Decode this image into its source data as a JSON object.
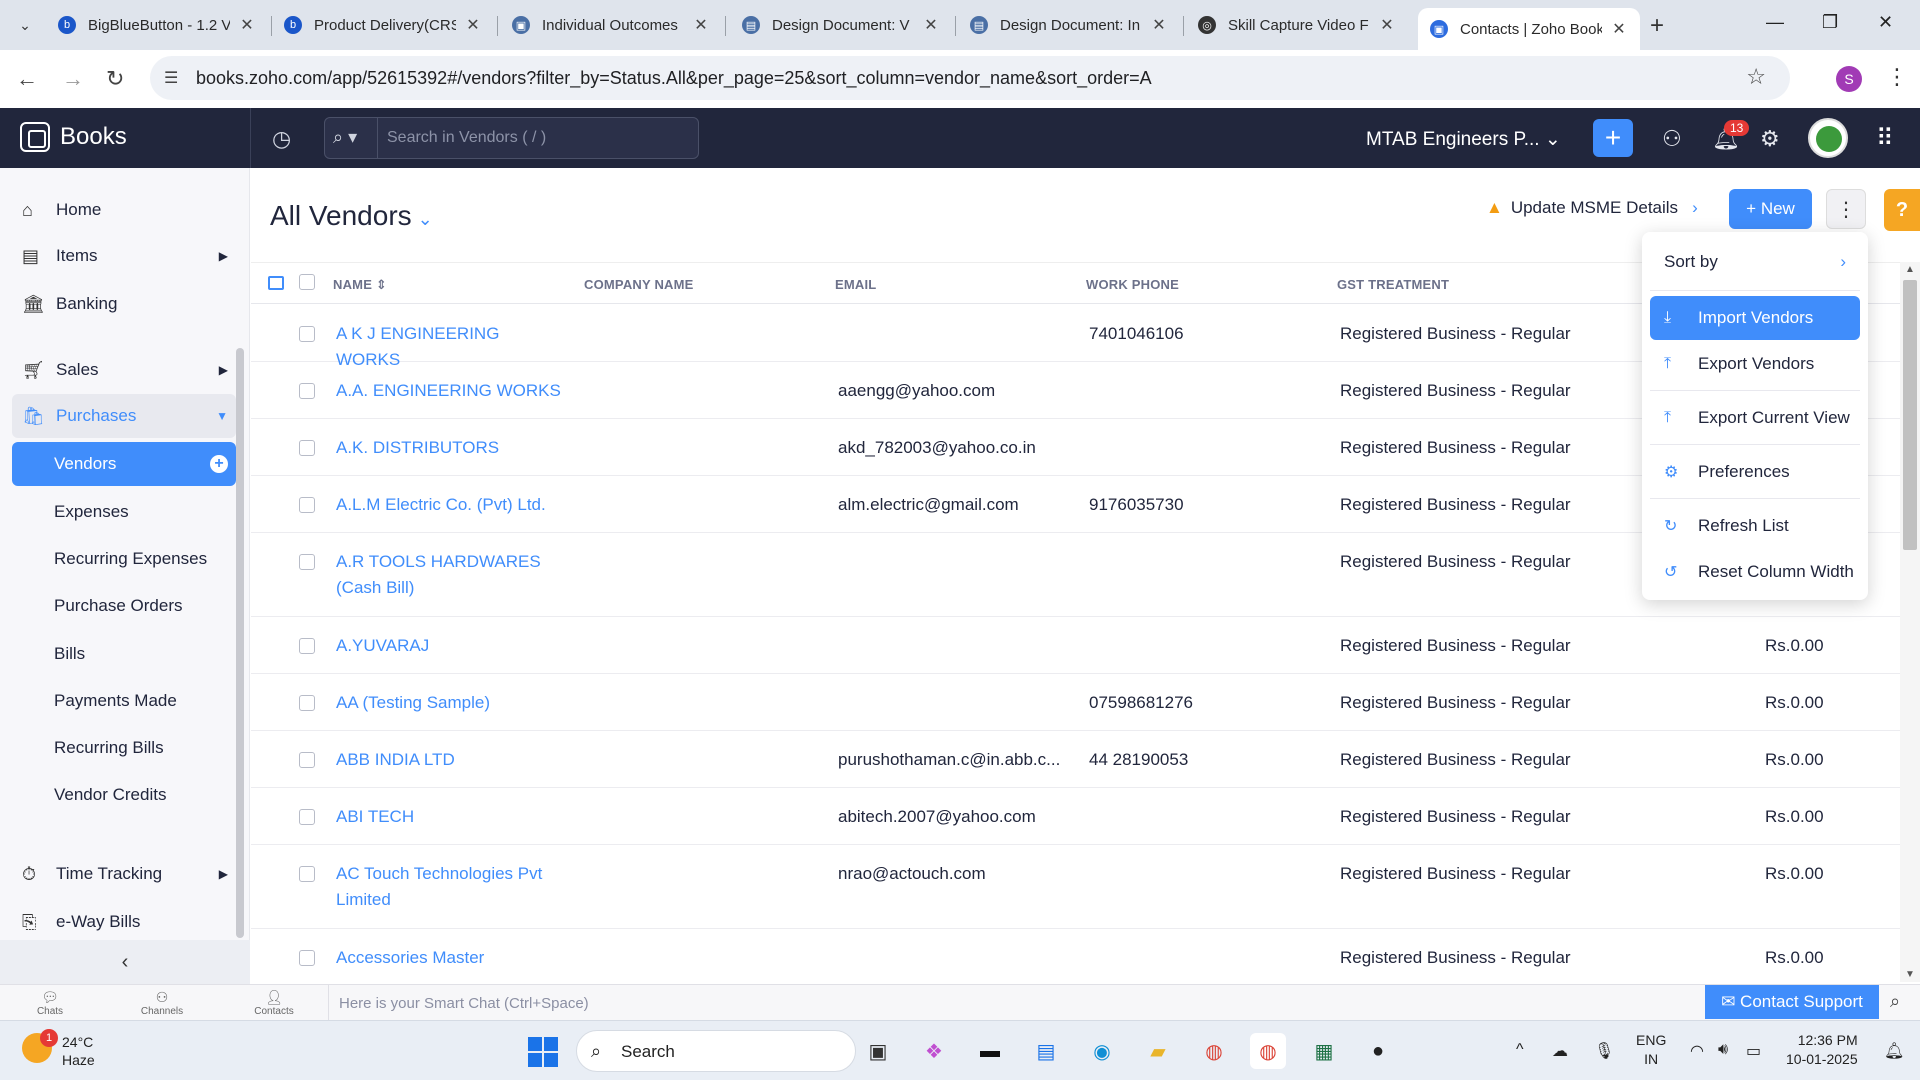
{
  "browser": {
    "tabs": [
      {
        "title": "BigBlueButton - 1.2 V",
        "color": "#1a56c9",
        "glyph": "b"
      },
      {
        "title": "Product Delivery(CRS",
        "color": "#1a56c9",
        "glyph": "b"
      },
      {
        "title": "Individual Outcomes",
        "color": "#4a6fa5",
        "glyph": "▣"
      },
      {
        "title": "Design Document: V",
        "color": "#4a6fa5",
        "glyph": "▤"
      },
      {
        "title": "Design Document: In",
        "color": "#4a6fa5",
        "glyph": "▤"
      },
      {
        "title": "Skill Capture Video F",
        "color": "#333333",
        "glyph": "◎"
      },
      {
        "title": "Contacts | Zoho Book",
        "color": "#2d6cdf",
        "glyph": "▣"
      }
    ],
    "url": "books.zoho.com/app/52615392#/vendors?filter_by=Status.All&per_page=25&sort_column=vendor_name&sort_order=A",
    "profile_initial": "S"
  },
  "app": {
    "name": "Books",
    "search_placeholder": "Search in Vendors ( / )",
    "org_name": "MTAB Engineers P...",
    "notifications": "13"
  },
  "sidebar": {
    "items": [
      {
        "label": "Home",
        "icon": "home-icon"
      },
      {
        "label": "Items",
        "icon": "items-icon"
      },
      {
        "label": "Banking",
        "icon": "bank-icon"
      },
      {
        "label": "Sales",
        "icon": "cart-icon"
      },
      {
        "label": "Purchases",
        "icon": "bag-icon"
      }
    ],
    "purchases_sub": [
      "Vendors",
      "Expenses",
      "Recurring Expenses",
      "Purchase Orders",
      "Bills",
      "Payments Made",
      "Recurring Bills",
      "Vendor Credits"
    ],
    "lower": [
      {
        "label": "Time Tracking",
        "icon": "timer-icon"
      },
      {
        "label": "e-Way Bills",
        "icon": "eway-icon"
      }
    ]
  },
  "page": {
    "title": "All Vendors",
    "msme_label": "Update MSME Details",
    "new_label": "New"
  },
  "table": {
    "columns": [
      "NAME",
      "COMPANY NAME",
      "EMAIL",
      "WORK PHONE",
      "GST TREATMENT"
    ],
    "rows": [
      {
        "name": "A K J ENGINEERING WORKS",
        "email": "",
        "phone": "7401046106",
        "gst": "Registered Business - Regular",
        "payable": ""
      },
      {
        "name": "A.A. ENGINEERING WORKS",
        "email": "aaengg@yahoo.com",
        "phone": "",
        "gst": "Registered Business - Regular",
        "payable": ""
      },
      {
        "name": "A.K. DISTRIBUTORS",
        "email": "akd_782003@yahoo.co.in",
        "phone": "",
        "gst": "Registered Business - Regular",
        "payable": ""
      },
      {
        "name": "A.L.M Electric Co. (Pvt) Ltd.",
        "email": "alm.electric@gmail.com",
        "phone": "9176035730",
        "gst": "Registered Business - Regular",
        "payable": ""
      },
      {
        "name": "A.R TOOLS HARDWARES (Cash Bill)",
        "email": "",
        "phone": "",
        "gst": "Registered Business - Regular",
        "payable": ""
      },
      {
        "name": "A.YUVARAJ",
        "email": "",
        "phone": "",
        "gst": "Registered Business - Regular",
        "payable": "Rs.0.00"
      },
      {
        "name": "AA (Testing Sample)",
        "email": "",
        "phone": "07598681276",
        "gst": "Registered Business - Regular",
        "payable": "Rs.0.00"
      },
      {
        "name": "ABB INDIA LTD",
        "email": "purushothaman.c@in.abb.c...",
        "phone": "44 28190053",
        "gst": "Registered Business - Regular",
        "payable": "Rs.0.00"
      },
      {
        "name": "ABI TECH",
        "email": "abitech.2007@yahoo.com",
        "phone": "",
        "gst": "Registered Business - Regular",
        "payable": "Rs.0.00"
      },
      {
        "name": "AC Touch Technologies Pvt Limited",
        "email": "nrao@actouch.com",
        "phone": "",
        "gst": "Registered Business - Regular",
        "payable": "Rs.0.00"
      },
      {
        "name": "Accessories Master",
        "email": "",
        "phone": "",
        "gst": "Registered Business - Regular",
        "payable": "Rs.0.00"
      }
    ]
  },
  "menu": {
    "sort_by": "Sort by",
    "import": "Import Vendors",
    "export": "Export Vendors",
    "export_view": "Export Current View",
    "preferences": "Preferences",
    "refresh": "Refresh List",
    "reset": "Reset Column Width"
  },
  "chat": {
    "tabs": [
      "Chats",
      "Channels",
      "Contacts"
    ],
    "placeholder": "Here is your Smart Chat (Ctrl+Space)",
    "support": "Contact Support"
  },
  "taskbar": {
    "temp": "24°C",
    "weather": "Haze",
    "weather_badge": "1",
    "search": "Search",
    "lang1": "ENG",
    "lang2": "IN",
    "time": "12:36 PM",
    "date": "10-01-2025"
  },
  "colors": {
    "accent": "#408dfb",
    "header": "#21263c",
    "warning": "#f39c12"
  }
}
